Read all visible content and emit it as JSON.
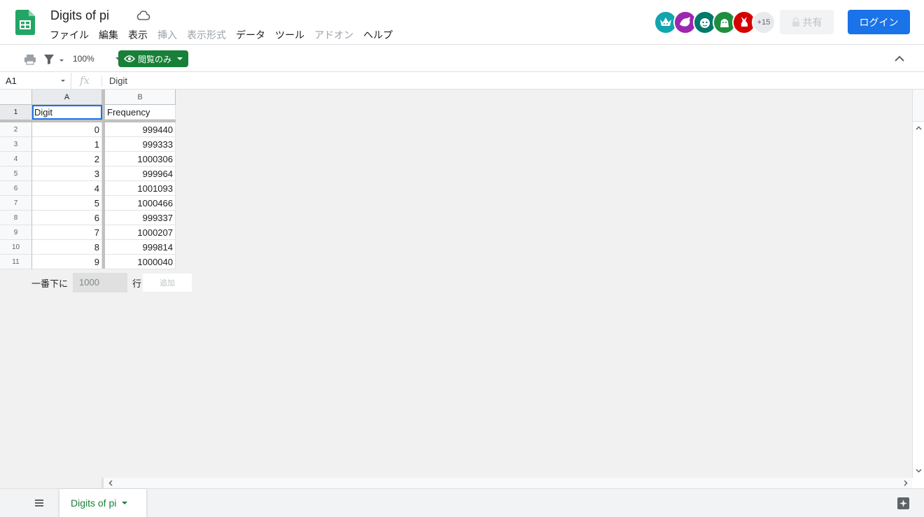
{
  "doc": {
    "title": "Digits of pi"
  },
  "menu": [
    "ファイル",
    "編集",
    "表示",
    "挿入",
    "表示形式",
    "データ",
    "ツール",
    "アドオン",
    "ヘルプ"
  ],
  "menu_disabled": [
    "挿入",
    "表示形式",
    "アドオン"
  ],
  "avatars": {
    "more_count": "+15",
    "colors": [
      "#12a4af",
      "#9c27b0",
      "#00796b",
      "#1e8e3e",
      "#d50000"
    ]
  },
  "header": {
    "share_label": "共有",
    "login_label": "ログイン"
  },
  "toolbar": {
    "zoom": "100%",
    "view_only_label": "閲覧のみ"
  },
  "formula_bar": {
    "cell_ref": "A1",
    "fx_symbol": "fx",
    "content": "Digit"
  },
  "grid": {
    "columns": [
      "A",
      "B"
    ],
    "row_numbers": [
      "1",
      "2",
      "3",
      "4",
      "5",
      "6",
      "7",
      "8",
      "9",
      "10",
      "11"
    ],
    "header": [
      "Digit",
      "Frequency"
    ],
    "rows": [
      [
        "0",
        "999440"
      ],
      [
        "1",
        "999333"
      ],
      [
        "2",
        "1000306"
      ],
      [
        "3",
        "999964"
      ],
      [
        "4",
        "1001093"
      ],
      [
        "5",
        "1000466"
      ],
      [
        "6",
        "999337"
      ],
      [
        "7",
        "1000207"
      ],
      [
        "8",
        "999814"
      ],
      [
        "9",
        "1000040"
      ]
    ]
  },
  "add_rows": {
    "prefix": "一番下に",
    "value": "1000",
    "unit": "行",
    "button": "追加"
  },
  "sheet_tab": {
    "name": "Digits of pi"
  },
  "colors": {
    "brand_green": "#188038",
    "accent_blue": "#1a73e8"
  }
}
